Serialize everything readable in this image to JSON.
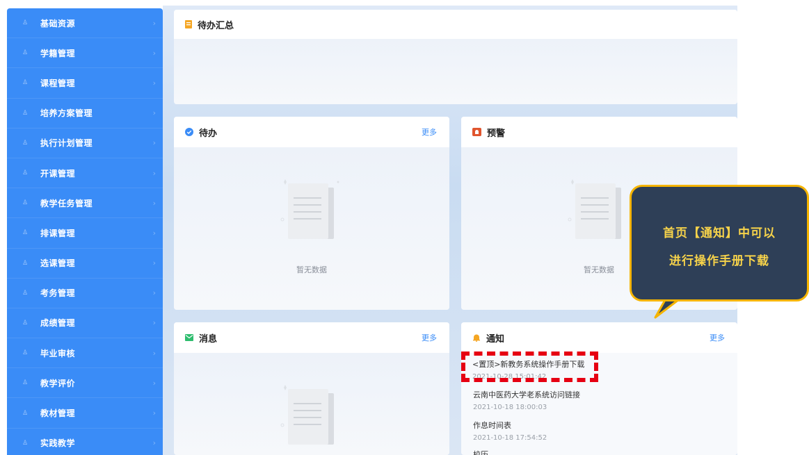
{
  "sidebar": {
    "items": [
      {
        "label": "基础资源"
      },
      {
        "label": "学籍管理"
      },
      {
        "label": "课程管理"
      },
      {
        "label": "培养方案管理"
      },
      {
        "label": "执行计划管理"
      },
      {
        "label": "开课管理"
      },
      {
        "label": "教学任务管理"
      },
      {
        "label": "排课管理"
      },
      {
        "label": "选课管理"
      },
      {
        "label": "考务管理"
      },
      {
        "label": "成绩管理"
      },
      {
        "label": "毕业审核"
      },
      {
        "label": "教学评价"
      },
      {
        "label": "教材管理"
      },
      {
        "label": "实践教学"
      }
    ]
  },
  "summary": {
    "title": "待办汇总"
  },
  "todo": {
    "title": "待办",
    "more": "更多",
    "empty": "暂无数据"
  },
  "warning": {
    "title": "预警",
    "empty": "暂无数据"
  },
  "messages": {
    "title": "消息",
    "more": "更多"
  },
  "notices": {
    "title": "通知",
    "more": "更多",
    "items": [
      {
        "title": "<置顶>新教务系统操作手册下载",
        "time": "2021-10-28 15:01:42"
      },
      {
        "title": "云南中医药大学老系统访问链接",
        "time": "2021-10-18 18:00:03"
      },
      {
        "title": "作息时间表",
        "time": "2021-10-18 17:54:52"
      },
      {
        "title": "校历",
        "time": ""
      }
    ]
  },
  "callout": {
    "line1": "首页【通知】中可以",
    "line2": "进行操作手册下载"
  },
  "colors": {
    "sidebar": "#3a8cf7",
    "highlight": "#e60012",
    "callout_bg": "#2e3f57",
    "callout_border": "#f5b400",
    "callout_text": "#f7d34a"
  }
}
